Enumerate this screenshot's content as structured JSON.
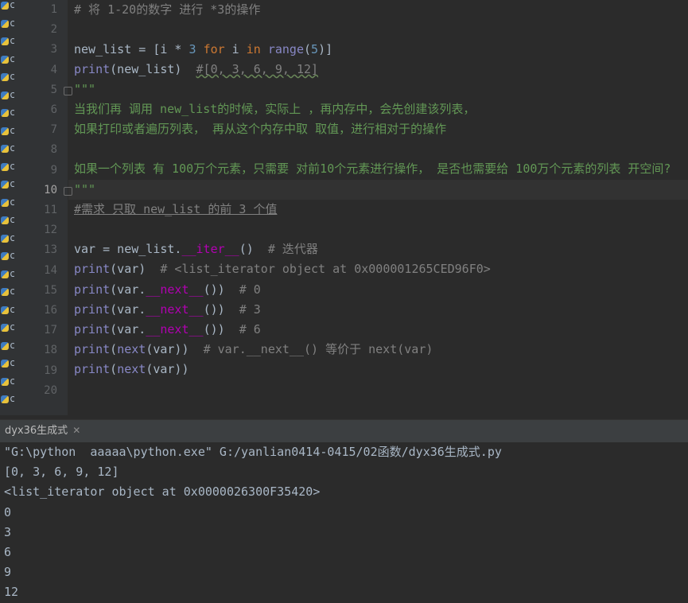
{
  "editor": {
    "line_numbers": [
      "1",
      "2",
      "3",
      "4",
      "5",
      "6",
      "7",
      "8",
      "9",
      "10",
      "11",
      "12",
      "13",
      "14",
      "15",
      "16",
      "17",
      "18",
      "19",
      "20"
    ],
    "current_line": "10",
    "lines": {
      "l1": "# 将 1-20的数字 进行 *3的操作",
      "l3a": "new_list = [i * ",
      "l3b": "3",
      "l3c": " ",
      "l3d": "for",
      "l3e": " i ",
      "l3f": "in",
      "l3g": " ",
      "l3h": "range",
      "l3i": "(",
      "l3j": "5",
      "l3k": ")]",
      "l4a": "print",
      "l4b": "(new_list)  ",
      "l4c": "#[0, 3, 6, 9, 12]",
      "l5": "\"\"\"",
      "l6": "当我们再 调用 new_list的时候，实际上 ，再内存中，会先创建该列表，",
      "l7": "如果打印或者遍历列表， 再从这个内存中取 取值，进行相对于的操作",
      "l9": "如果一个列表 有 100万个元素，只需要 对前10个元素进行操作， 是否也需要给 100万个元素的列表 开空间?",
      "l10": "\"\"\"",
      "l11": "#需求 只取 new_list 的前 3 个值",
      "l13a": "var = new_list.",
      "l13b": "__iter__",
      "l13c": "()  ",
      "l13d": "# 迭代器",
      "l14a": "print",
      "l14b": "(var)  ",
      "l14c": "# <list_iterator object at 0x000001265CED96F0>",
      "l15a": "print",
      "l15b": "(var.",
      "l15c": "__next__",
      "l15d": "())  ",
      "l15e": "# 0",
      "l16a": "print",
      "l16b": "(var.",
      "l16c": "__next__",
      "l16d": "())  ",
      "l16e": "# 3",
      "l17a": "print",
      "l17b": "(var.",
      "l17c": "__next__",
      "l17d": "())  ",
      "l17e": "# 6",
      "l18a": "print",
      "l18b": "(",
      "l18c": "next",
      "l18d": "(var))  ",
      "l18e": "# var.__next__() 等价于 next(var)",
      "l19a": "print",
      "l19b": "(",
      "l19c": "next",
      "l19d": "(var))"
    }
  },
  "left_strip": {
    "item_char": "c",
    "icon": "python-file-icon"
  },
  "run_panel": {
    "tab_label": "dyx36生成式",
    "close_icon": "close-icon",
    "output": [
      "\"G:\\python  aaaaa\\python.exe\" G:/yanlian0414-0415/02函数/dyx36生成式.py",
      "[0, 3, 6, 9, 12]",
      "<list_iterator object at 0x0000026300F35420>",
      "0",
      "3",
      "6",
      "9",
      "12"
    ]
  },
  "colors": {
    "background": "#2b2b2b",
    "gutter": "#313335",
    "keyword": "#cc7832",
    "number": "#6897bb",
    "builtin": "#8888c6",
    "dunder": "#b200b2",
    "comment": "#808080",
    "docstring": "#629755",
    "tab_underline": "#4a88c7"
  }
}
